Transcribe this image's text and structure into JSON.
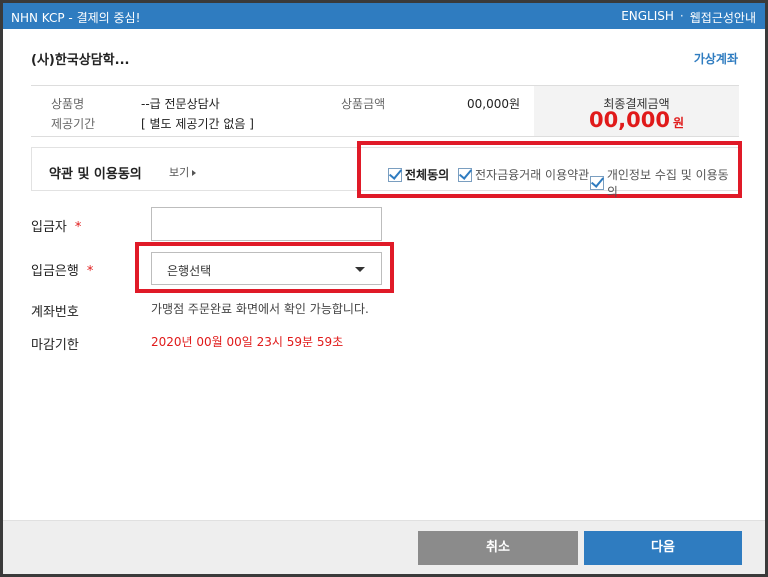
{
  "titlebar": {
    "left": "NHN KCP - 결제의 중심!",
    "english": "ENGLISH",
    "separator": "·",
    "accessibility": "웹접근성안내"
  },
  "merchant": {
    "name": "(사)한국상담학...",
    "pay_type": "가상계좌"
  },
  "summary": {
    "product_label": "상품명",
    "product_value": "--급 전문상담사",
    "period_label": "제공기간",
    "period_value": "[ 별도 제공기간 없음 ]",
    "price_label": "상품금액",
    "price_value": "00,000원",
    "total_label": "최종결제금액",
    "total_value": "00,000",
    "total_unit": "원"
  },
  "terms": {
    "title": "약관 및 이용동의",
    "view": "보기",
    "agree_all": "전체동의",
    "agree_efin": "전자금융거래 이용약관",
    "agree_privacy": "개인정보 수집 및 이용동의"
  },
  "form": {
    "depositor_label": "입금자",
    "depositor_value": "",
    "required_mark": "*",
    "bank_label": "입금은행",
    "bank_selected": "은행선택",
    "account_label": "계좌번호",
    "account_value": "가맹점 주문완료 화면에서 확인 가능합니다.",
    "deadline_label": "마감기한",
    "deadline_value": "2020년 00월 00일 23시 59분 59초"
  },
  "footer": {
    "cancel": "취소",
    "next": "다음"
  },
  "colors": {
    "brand": "#2f7cc0",
    "highlight": "#e01a28",
    "price": "#e01a1a"
  }
}
